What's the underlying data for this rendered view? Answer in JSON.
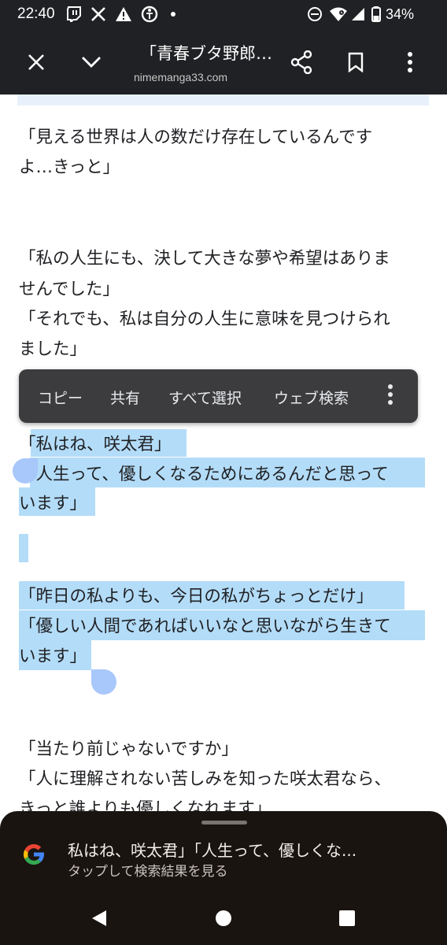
{
  "status_bar": {
    "time": "22:40",
    "battery_percent": "34%",
    "icons": [
      "twitch-icon",
      "x-icon",
      "warning-icon",
      "accessibility-icon",
      "dot-icon",
      "dnd-icon",
      "wifi-icon",
      "signal-icon",
      "battery-icon"
    ]
  },
  "toolbar": {
    "title": "「青春ブタ野郎…",
    "url": "nimemanga33.com"
  },
  "article": {
    "lines": [
      "「見える世界は人の数だけ存在しているんです",
      "よ…きっと」",
      "「私の人生にも、決して大きな夢や希望はありま",
      "せんでした」",
      "「それでも、私は自分の人生に意味を見つけられ",
      "ました」",
      "「私はね、咲太君」",
      "「人生って、優しくなるためにあるんだと思って",
      "います」",
      "「昨日の私よりも、今日の私がちょっとだけ」",
      "「優しい人間であればいいなと思いながら生きて",
      "います」",
      "「当たり前じゃないですか」",
      "「人に理解されない苦しみを知った咲太君なら、",
      "きっと誰よりも優しくなれます」"
    ]
  },
  "context_menu": {
    "copy": "コピー",
    "share": "共有",
    "select_all": "すべて選択",
    "web_search": "ウェブ検索"
  },
  "search_sheet": {
    "query": "私はね、咲太君」「人生って、優しくな...",
    "subtitle": "タップして検索結果を見る"
  },
  "colors": {
    "selection": "#b3dcf8",
    "handle": "#a8c7fa",
    "toolbar_bg": "#202124",
    "sheet_bg": "#1a1410"
  }
}
